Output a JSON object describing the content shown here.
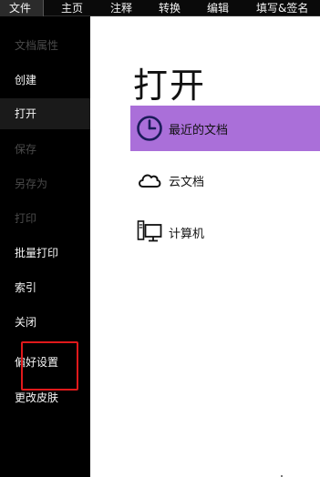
{
  "tabs": [
    {
      "label": "文件",
      "active": true
    },
    {
      "label": "主页",
      "active": false
    },
    {
      "label": "注释",
      "active": false
    },
    {
      "label": "转换",
      "active": false
    },
    {
      "label": "编辑",
      "active": false
    },
    {
      "label": "填写&签名",
      "active": false
    }
  ],
  "sidebar": {
    "items": [
      {
        "label": "文档属性",
        "enabled": false
      },
      {
        "label": "创建",
        "enabled": true
      },
      {
        "label": "打开",
        "enabled": true,
        "selected": true
      },
      {
        "label": "保存",
        "enabled": false
      },
      {
        "label": "另存为",
        "enabled": false
      },
      {
        "label": "打印",
        "enabled": false
      },
      {
        "label": "批量打印",
        "enabled": true
      },
      {
        "label": "索引",
        "enabled": true
      },
      {
        "label": "关闭",
        "enabled": true
      },
      {
        "label": "偏好设置",
        "enabled": true
      },
      {
        "label": "更改皮肤",
        "enabled": true
      }
    ]
  },
  "main": {
    "title": "打开",
    "locations": [
      {
        "label": "最近的文档",
        "icon": "clock-icon",
        "selected": true
      },
      {
        "label": "云文档",
        "icon": "cloud-icon",
        "selected": false
      },
      {
        "label": "计算机",
        "icon": "computer-icon",
        "selected": false
      }
    ]
  },
  "colors": {
    "selected_location": "#aa6fd9",
    "annotation_box": "#e0191b",
    "sidebar_bg": "#000000"
  }
}
